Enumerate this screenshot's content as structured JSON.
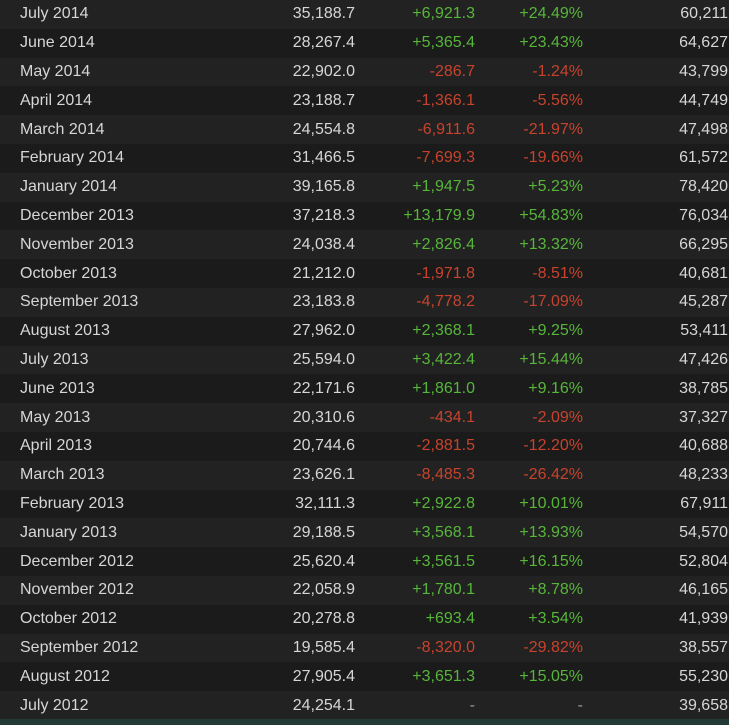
{
  "colors": {
    "positive": "#57b63a",
    "negative": "#c7432d",
    "text": "#d6d6d6",
    "background": "#1b1b1b",
    "row_alt": "#222222"
  },
  "rows": [
    {
      "month": "July 2014",
      "avg": "35,188.7",
      "gain": "+6,921.3",
      "pct": "+24.49%",
      "peak": "60,211",
      "trend": "pos"
    },
    {
      "month": "June 2014",
      "avg": "28,267.4",
      "gain": "+5,365.4",
      "pct": "+23.43%",
      "peak": "64,627",
      "trend": "pos"
    },
    {
      "month": "May 2014",
      "avg": "22,902.0",
      "gain": "-286.7",
      "pct": "-1.24%",
      "peak": "43,799",
      "trend": "neg"
    },
    {
      "month": "April 2014",
      "avg": "23,188.7",
      "gain": "-1,366.1",
      "pct": "-5.56%",
      "peak": "44,749",
      "trend": "neg"
    },
    {
      "month": "March 2014",
      "avg": "24,554.8",
      "gain": "-6,911.6",
      "pct": "-21.97%",
      "peak": "47,498",
      "trend": "neg"
    },
    {
      "month": "February 2014",
      "avg": "31,466.5",
      "gain": "-7,699.3",
      "pct": "-19.66%",
      "peak": "61,572",
      "trend": "neg"
    },
    {
      "month": "January 2014",
      "avg": "39,165.8",
      "gain": "+1,947.5",
      "pct": "+5.23%",
      "peak": "78,420",
      "trend": "pos"
    },
    {
      "month": "December 2013",
      "avg": "37,218.3",
      "gain": "+13,179.9",
      "pct": "+54.83%",
      "peak": "76,034",
      "trend": "pos"
    },
    {
      "month": "November 2013",
      "avg": "24,038.4",
      "gain": "+2,826.4",
      "pct": "+13.32%",
      "peak": "66,295",
      "trend": "pos"
    },
    {
      "month": "October 2013",
      "avg": "21,212.0",
      "gain": "-1,971.8",
      "pct": "-8.51%",
      "peak": "40,681",
      "trend": "neg"
    },
    {
      "month": "September 2013",
      "avg": "23,183.8",
      "gain": "-4,778.2",
      "pct": "-17.09%",
      "peak": "45,287",
      "trend": "neg"
    },
    {
      "month": "August 2013",
      "avg": "27,962.0",
      "gain": "+2,368.1",
      "pct": "+9.25%",
      "peak": "53,411",
      "trend": "pos"
    },
    {
      "month": "July 2013",
      "avg": "25,594.0",
      "gain": "+3,422.4",
      "pct": "+15.44%",
      "peak": "47,426",
      "trend": "pos"
    },
    {
      "month": "June 2013",
      "avg": "22,171.6",
      "gain": "+1,861.0",
      "pct": "+9.16%",
      "peak": "38,785",
      "trend": "pos"
    },
    {
      "month": "May 2013",
      "avg": "20,310.6",
      "gain": "-434.1",
      "pct": "-2.09%",
      "peak": "37,327",
      "trend": "neg"
    },
    {
      "month": "April 2013",
      "avg": "20,744.6",
      "gain": "-2,881.5",
      "pct": "-12.20%",
      "peak": "40,688",
      "trend": "neg"
    },
    {
      "month": "March 2013",
      "avg": "23,626.1",
      "gain": "-8,485.3",
      "pct": "-26.42%",
      "peak": "48,233",
      "trend": "neg"
    },
    {
      "month": "February 2013",
      "avg": "32,111.3",
      "gain": "+2,922.8",
      "pct": "+10.01%",
      "peak": "67,911",
      "trend": "pos"
    },
    {
      "month": "January 2013",
      "avg": "29,188.5",
      "gain": "+3,568.1",
      "pct": "+13.93%",
      "peak": "54,570",
      "trend": "pos"
    },
    {
      "month": "December 2012",
      "avg": "25,620.4",
      "gain": "+3,561.5",
      "pct": "+16.15%",
      "peak": "52,804",
      "trend": "pos"
    },
    {
      "month": "November 2012",
      "avg": "22,058.9",
      "gain": "+1,780.1",
      "pct": "+8.78%",
      "peak": "46,165",
      "trend": "pos"
    },
    {
      "month": "October 2012",
      "avg": "20,278.8",
      "gain": "+693.4",
      "pct": "+3.54%",
      "peak": "41,939",
      "trend": "pos"
    },
    {
      "month": "September 2012",
      "avg": "19,585.4",
      "gain": "-8,320.0",
      "pct": "-29.82%",
      "peak": "38,557",
      "trend": "neg"
    },
    {
      "month": "August 2012",
      "avg": "27,905.4",
      "gain": "+3,651.3",
      "pct": "+15.05%",
      "peak": "55,230",
      "trend": "pos"
    },
    {
      "month": "July 2012",
      "avg": "24,254.1",
      "gain": "-",
      "pct": "-",
      "peak": "39,658",
      "trend": "none"
    }
  ]
}
